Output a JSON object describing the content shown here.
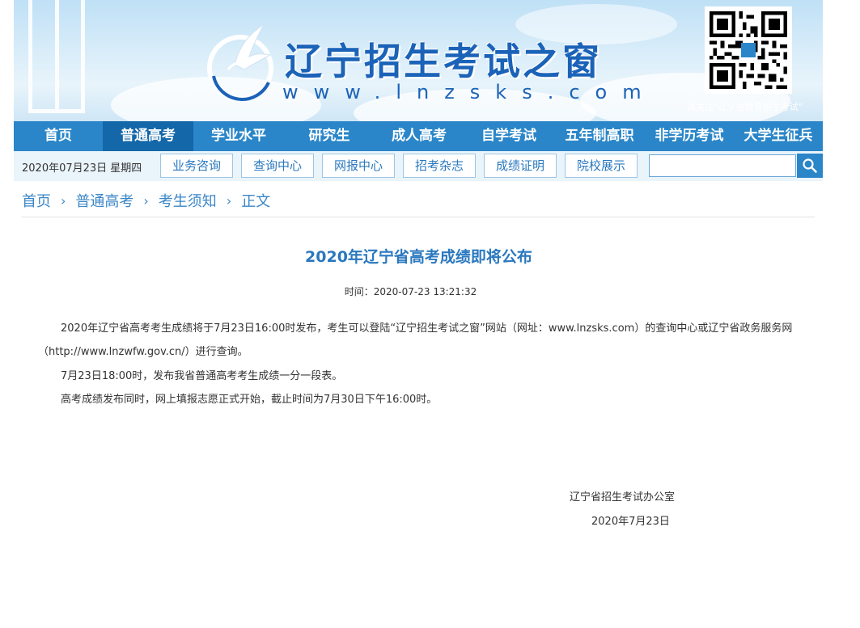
{
  "header": {
    "site_title": "辽宁招生考试之窗",
    "site_url": "www.lnzsks.com",
    "qr_caption": "请关注“辽宁省教育招生考试”"
  },
  "nav": {
    "items": [
      {
        "label": "首页"
      },
      {
        "label": "普通高考"
      },
      {
        "label": "学业水平"
      },
      {
        "label": "研究生"
      },
      {
        "label": "成人高考"
      },
      {
        "label": "自学考试"
      },
      {
        "label": "五年制高职"
      },
      {
        "label": "非学历考试"
      },
      {
        "label": "大学生征兵"
      }
    ],
    "active_index": 1
  },
  "subbar": {
    "date": "2020年07月23日 星期四",
    "buttons": [
      {
        "label": "业务咨询"
      },
      {
        "label": "查询中心"
      },
      {
        "label": "网报中心"
      },
      {
        "label": "招考杂志"
      },
      {
        "label": "成绩证明"
      },
      {
        "label": "院校展示"
      }
    ],
    "search_placeholder": "",
    "search_value": ""
  },
  "breadcrumb": {
    "items": [
      "首页",
      "普通高考",
      "考生须知",
      "正文"
    ],
    "separator": "›"
  },
  "article": {
    "title": "2020年辽宁省高考成绩即将公布",
    "time": "时间：2020-07-23 13:21:32",
    "paragraphs": [
      "2020年辽宁省高考考生成绩将于7月23日16:00时发布，考生可以登陆“辽宁招生考试之窗”网站（网址：www.lnzsks.com）的查询中心或辽宁省政务服务网（http://www.lnzwfw.gov.cn/）进行查询。",
      "7月23日18:00时，发布我省普通高考考生成绩一分一段表。",
      "高考成绩发布同时，网上填报志愿正式开始，截止时间为7月30日下午16:00时。"
    ],
    "signature_org": "辽宁省招生考试办公室",
    "signature_date": "2020年7月23日"
  },
  "colors": {
    "nav_bg": "#2a86c8",
    "nav_active": "#1467a8",
    "accent": "#2a78bf",
    "subbar_bg": "#eaf4fb"
  },
  "icons": {
    "search": "search-icon",
    "logo": "dove-logo-icon",
    "qr": "qr-code-icon"
  }
}
